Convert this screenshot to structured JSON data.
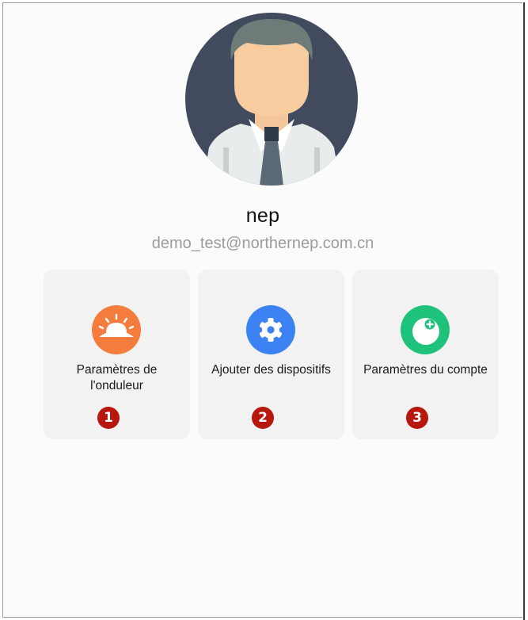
{
  "profile": {
    "name": "nep",
    "email": "demo_test@northernep.com.cn",
    "avatar_icon": "user-avatar-icon"
  },
  "cards": [
    {
      "label": "Paramètres de l'onduleur",
      "badge": "1",
      "icon": "sunrise-icon",
      "color": "#f47c3c"
    },
    {
      "label": "Ajouter des dispositifs",
      "badge": "2",
      "icon": "gear-icon",
      "color": "#3d82f2"
    },
    {
      "label": "Paramètres du compte",
      "badge": "3",
      "icon": "account-plus-icon",
      "color": "#1fc27a"
    }
  ],
  "colors": {
    "badge": "#b8170d",
    "card_bg": "#f2f2f2",
    "email_text": "#9c9c9c"
  }
}
